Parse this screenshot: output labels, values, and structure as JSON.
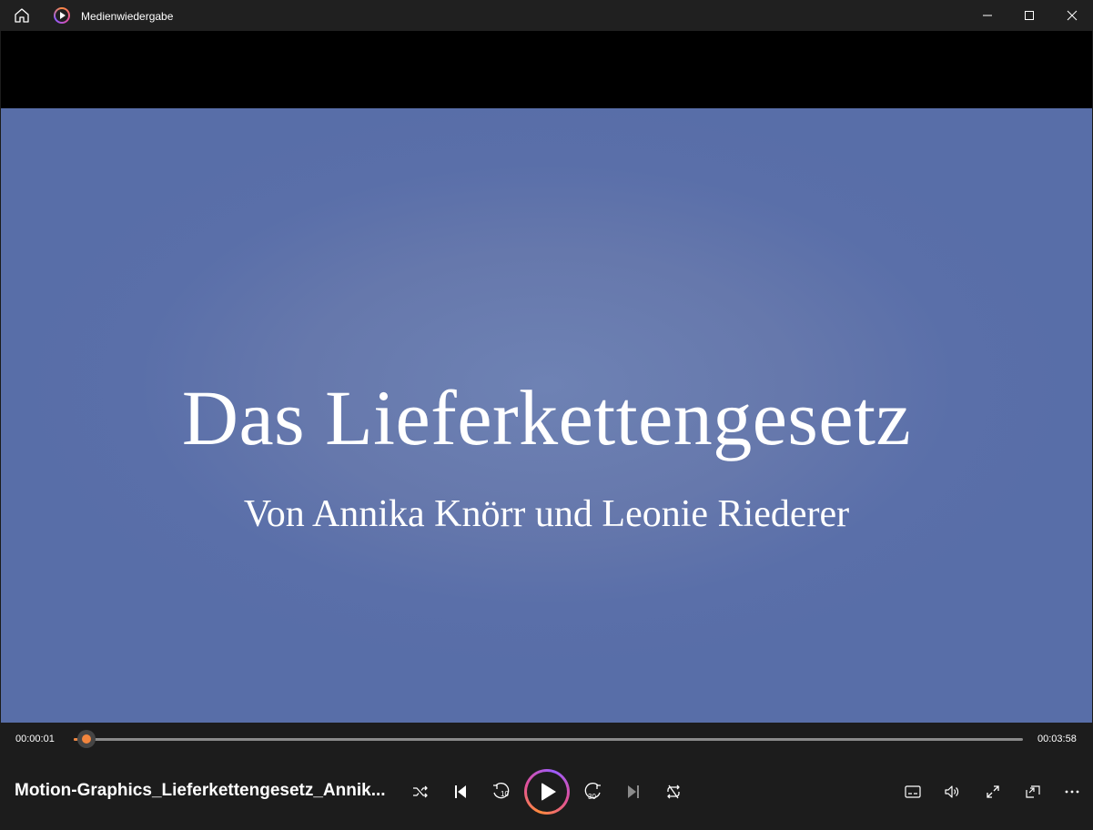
{
  "window": {
    "app_title": "Medienwiedergabe",
    "buttons": {
      "home_icon": "home-icon",
      "minimize_icon": "minimize-icon",
      "maximize_icon": "maximize-icon",
      "close_icon": "close-icon"
    }
  },
  "video": {
    "title": "Das Lieferkettengesetz",
    "subtitle": "Von Annika Knörr und Leonie Riederer",
    "background_color": "#5f74aa"
  },
  "player": {
    "current_time": "00:00:01",
    "duration": "00:03:58",
    "progress": 0.004,
    "media_title": "Motion-Graphics_Lieferkettengesetz_Annik...",
    "accent_color": "#f2853d",
    "controls": [
      "shuffle-icon",
      "previous-icon",
      "rewind-10-icon",
      "play-icon",
      "forward-30-icon",
      "next-icon",
      "repeat-icon"
    ],
    "right_controls": [
      "subtitles-icon",
      "volume-icon",
      "fullscreen-icon",
      "miniplayer-icon",
      "more-icon"
    ],
    "rewind_label": "10",
    "forward_label": "30"
  }
}
